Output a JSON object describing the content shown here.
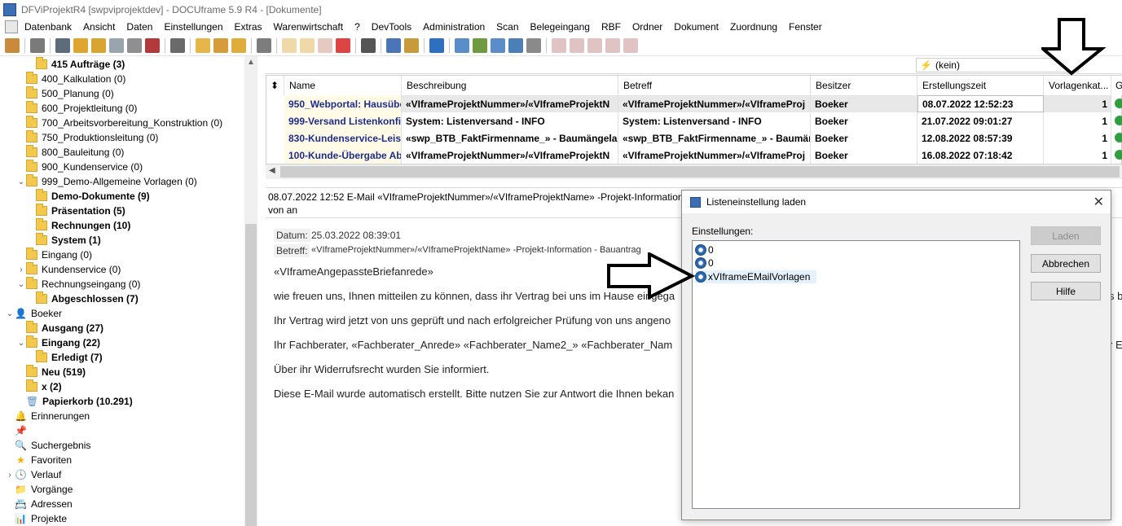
{
  "window": {
    "title": "DFViProjektR4 [swpviprojektdev] - DOCUframe 5.9 R4 - [Dokumente]"
  },
  "menu": [
    "Datenbank",
    "Ansicht",
    "Daten",
    "Einstellungen",
    "Extras",
    "Warenwirtschaft",
    "?",
    "DevTools",
    "Administration",
    "Scan",
    "Belegeingang",
    "RBF",
    "Ordner",
    "Dokument",
    "Zuordnung",
    "Fenster"
  ],
  "tree": {
    "items": [
      {
        "label": "415 Aufträge (3)",
        "bold": true,
        "indent": 2,
        "exp": ""
      },
      {
        "label": "400_Kalkulation (0)",
        "bold": false,
        "indent": 1,
        "exp": ""
      },
      {
        "label": "500_Planung (0)",
        "bold": false,
        "indent": 1,
        "exp": ""
      },
      {
        "label": "600_Projektleitung (0)",
        "bold": false,
        "indent": 1,
        "exp": ""
      },
      {
        "label": "700_Arbeitsvorbereitung_Konstruktion (0)",
        "bold": false,
        "indent": 1,
        "exp": ""
      },
      {
        "label": "750_Produktionsleitung (0)",
        "bold": false,
        "indent": 1,
        "exp": ""
      },
      {
        "label": "800_Bauleitung (0)",
        "bold": false,
        "indent": 1,
        "exp": ""
      },
      {
        "label": "900_Kundenservice (0)",
        "bold": false,
        "indent": 1,
        "exp": ""
      },
      {
        "label": "999_Demo-Allgemeine Vorlagen (0)",
        "bold": false,
        "indent": 1,
        "exp": "v"
      },
      {
        "label": "Demo-Dokumente (9)",
        "bold": true,
        "indent": 2,
        "exp": ""
      },
      {
        "label": "Präsentation (5)",
        "bold": true,
        "indent": 2,
        "exp": ""
      },
      {
        "label": "Rechnungen (10)",
        "bold": true,
        "indent": 2,
        "exp": ""
      },
      {
        "label": "System (1)",
        "bold": true,
        "indent": 2,
        "exp": ""
      },
      {
        "label": "Eingang (0)",
        "bold": false,
        "indent": 1,
        "exp": ""
      },
      {
        "label": "Kundenservice (0)",
        "bold": false,
        "indent": 1,
        "exp": ">"
      },
      {
        "label": "Rechnungseingang (0)",
        "bold": false,
        "indent": 1,
        "exp": "v"
      },
      {
        "label": "Abgeschlossen (7)",
        "bold": true,
        "indent": 2,
        "exp": ""
      },
      {
        "label": "Boeker",
        "bold": false,
        "indent": 0,
        "exp": "v",
        "icon": "user"
      },
      {
        "label": "Ausgang (27)",
        "bold": true,
        "indent": 1,
        "exp": ""
      },
      {
        "label": "Eingang (22)",
        "bold": true,
        "indent": 1,
        "exp": "v"
      },
      {
        "label": "Erledigt (7)",
        "bold": true,
        "indent": 2,
        "exp": ""
      },
      {
        "label": "Neu (519)",
        "bold": true,
        "indent": 1,
        "exp": ""
      },
      {
        "label": "x (2)",
        "bold": true,
        "indent": 1,
        "exp": ""
      },
      {
        "label": "Papierkorb (10.291)",
        "bold": true,
        "indent": 1,
        "exp": "",
        "icon": "trash"
      },
      {
        "label": "Erinnerungen",
        "bold": false,
        "indent": 0,
        "exp": "",
        "icon": "bell"
      },
      {
        "label": "",
        "bold": false,
        "indent": 0,
        "exp": "",
        "icon": "pin"
      },
      {
        "label": "Suchergebnis",
        "bold": false,
        "indent": 0,
        "exp": "",
        "icon": "search"
      },
      {
        "label": "Favoriten",
        "bold": false,
        "indent": 0,
        "exp": "",
        "icon": "star"
      },
      {
        "label": "Verlauf",
        "bold": false,
        "indent": 0,
        "exp": ">",
        "icon": "clock"
      },
      {
        "label": "Vorgänge",
        "bold": false,
        "indent": 0,
        "exp": "",
        "icon": "case"
      },
      {
        "label": "Adressen",
        "bold": false,
        "indent": 0,
        "exp": "",
        "icon": "addr"
      },
      {
        "label": "Projekte",
        "bold": false,
        "indent": 0,
        "exp": "",
        "icon": "proj"
      }
    ]
  },
  "filter": {
    "value": "(kein)"
  },
  "grid": {
    "columns": [
      "Name",
      "Beschreibung",
      "Betreff",
      "Besitzer",
      "Erstellungszeit",
      "Vorlagenkat...",
      "G"
    ],
    "rows": [
      {
        "name": "950_Webportal: Hausübe",
        "desc": "«VIframeProjektNummer»/«VIframeProjektN",
        "subj": "«VIframeProjektNummer»/«VIframeProj",
        "owner": "Boeker",
        "time": "08.07.2022 12:52:23",
        "cat": "1"
      },
      {
        "name": "999-Versand Listenkonfig",
        "desc": "System: Listenversand - INFO",
        "subj": "System: Listenversand - INFO",
        "owner": "Boeker",
        "time": "21.07.2022 09:01:27",
        "cat": "1"
      },
      {
        "name": "830-Kundenservice-Leist",
        "desc": "«swp_BTB_FaktFirmenname_» - Baumängelanz",
        "subj": "«swp_BTB_FaktFirmenname_» - Baumäng",
        "owner": "Boeker",
        "time": "12.08.2022 08:57:39",
        "cat": "1"
      },
      {
        "name": "100-Kunde-Übergabe Ab",
        "desc": "«VIframeProjektNummer»/«VIframeProjektN",
        "subj": "«VIframeProjektNummer»/«VIframeProj",
        "owner": "Boeker",
        "time": "16.08.2022 07:18:42",
        "cat": "1"
      }
    ]
  },
  "subject": {
    "line1": "08.07.2022 12:52 E-Mail «VIframeProjektNummer»/«VIframeProjektName» -Projekt-Information -",
    "line2": "von  an"
  },
  "preview": {
    "datum_label": "Datum:",
    "datum_value": "25.03.2022 08:39:01",
    "betreff_label": "Betreff:",
    "betreff_value": "«VIframeProjektNummer»/«VIframeProjektName» -Projekt-Information - Bauantrag",
    "lines": [
      "«VIframeAngepassteBriefanrede»",
      "wie freuen uns, Ihnen mitteilen zu können, dass ihr Vertrag bei uns im Hause eingega",
      "Ihr Vertrag wird jetzt von uns geprüft und nach erfolgreicher Prüfung von uns angeno",
      "Ihr Fachberater, «Fachberater_Anrede» «Fachberater_Name2_» «Fachberater_Nam",
      "Über ihr Widerrufsrecht wurden Sie informiert.",
      "Diese E-Mail wurde automatisch erstellt. Bitte nutzen Sie zur Antwort die Ihnen bekan"
    ],
    "right_fragment_1": "s b",
    "right_fragment_2": "r E"
  },
  "dialog": {
    "title": "Listeneinstellung laden",
    "label": "Einstellungen:",
    "items": [
      "0",
      "0",
      "xVIframeEMailVorlagen"
    ],
    "buttons": {
      "load": "Laden",
      "cancel": "Abbrechen",
      "help": "Hilfe"
    }
  },
  "colors": {
    "name_link": "#1d2d8c",
    "check_green": "#2e9e3e",
    "folder": "#f2c94c"
  }
}
